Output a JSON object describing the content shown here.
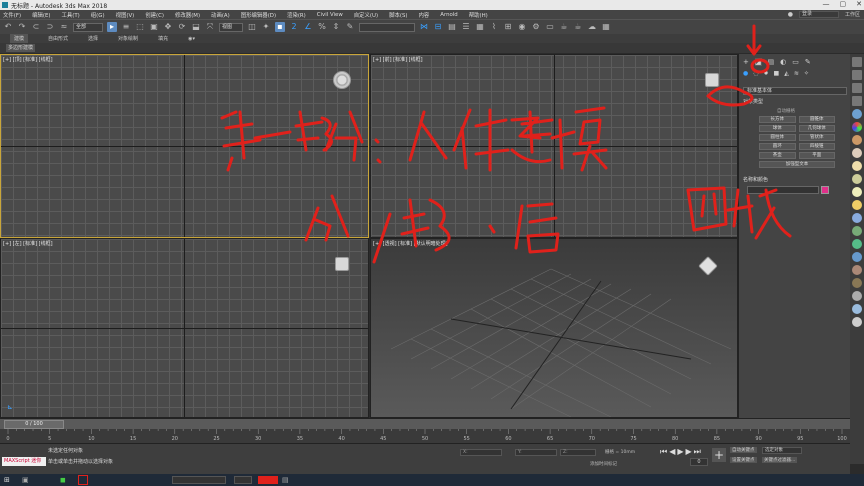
{
  "window": {
    "title": "无标题 - Autodesk 3ds Max 2018",
    "controls": [
      "—",
      "▢",
      "✕"
    ]
  },
  "menu": {
    "items": [
      "文件(F)",
      "编辑(E)",
      "工具(T)",
      "组(G)",
      "视图(V)",
      "创建(C)",
      "修改器(M)",
      "动画(A)",
      "图形编辑器(D)",
      "渲染(R)",
      "Civil View",
      "自定义(U)",
      "脚本(S)",
      "内容",
      "Arnold",
      "帮助(H)"
    ],
    "login": "登录",
    "workspace": "工作区"
  },
  "toolbar": {
    "selection_filter": "全部",
    "ref_coord": "视图",
    "named_sel": ""
  },
  "ribbon": {
    "tabs": [
      "建模",
      "自由形式",
      "选择",
      "对象绘制",
      "填充"
    ],
    "sub_label": "多边形建模"
  },
  "viewports": {
    "top_left": "[+] [顶] [标准] [线框]",
    "top_right": "[+] [前] [标准] [线框]",
    "bottom_left": "[+] [左] [标准] [线框]",
    "bottom_right": "[+] [透视] [标准] [默认明暗处理]"
  },
  "command_panel": {
    "category": "标准基本体",
    "rollout_object_type": "对象类型",
    "autogrid": "自动栅格",
    "buttons": [
      "长方体",
      "圆锥体",
      "球体",
      "几何球体",
      "圆柱体",
      "管状体",
      "圆环",
      "四棱锥",
      "茶壶",
      "平面",
      "加强型文本"
    ],
    "rollout_name_color": "名称和颜色",
    "name_color_hex": "#e0308a"
  },
  "timeline": {
    "slider_label": "0 / 100",
    "ticks": [
      "0",
      "5",
      "10",
      "15",
      "20",
      "25",
      "30",
      "35",
      "40",
      "45",
      "50",
      "55",
      "60",
      "65",
      "70",
      "75",
      "80",
      "85",
      "90",
      "95",
      "100"
    ]
  },
  "status": {
    "line1": "未选定任何对象",
    "line2": "单击或单击并拖动以选择对象",
    "maxscript": "MAXScript 迷你",
    "grid": "栅格 = 10mm",
    "add_time_tag": "添加时间标记",
    "auto_key": "自动关键点",
    "selected_object": "选定对象",
    "set_key": "设置关键点",
    "key_filters": "关键点过滤器...",
    "frame": "0"
  },
  "annotations": {
    "text_line1": "第一部分：人体建模",
    "text_line2": "白 / 线 ，偏",
    "text_right": "四肢",
    "ink_color": "#e0211b"
  },
  "colors": {
    "accent": "#3aa0ff",
    "viewport_active_border": "#c9a63a"
  }
}
